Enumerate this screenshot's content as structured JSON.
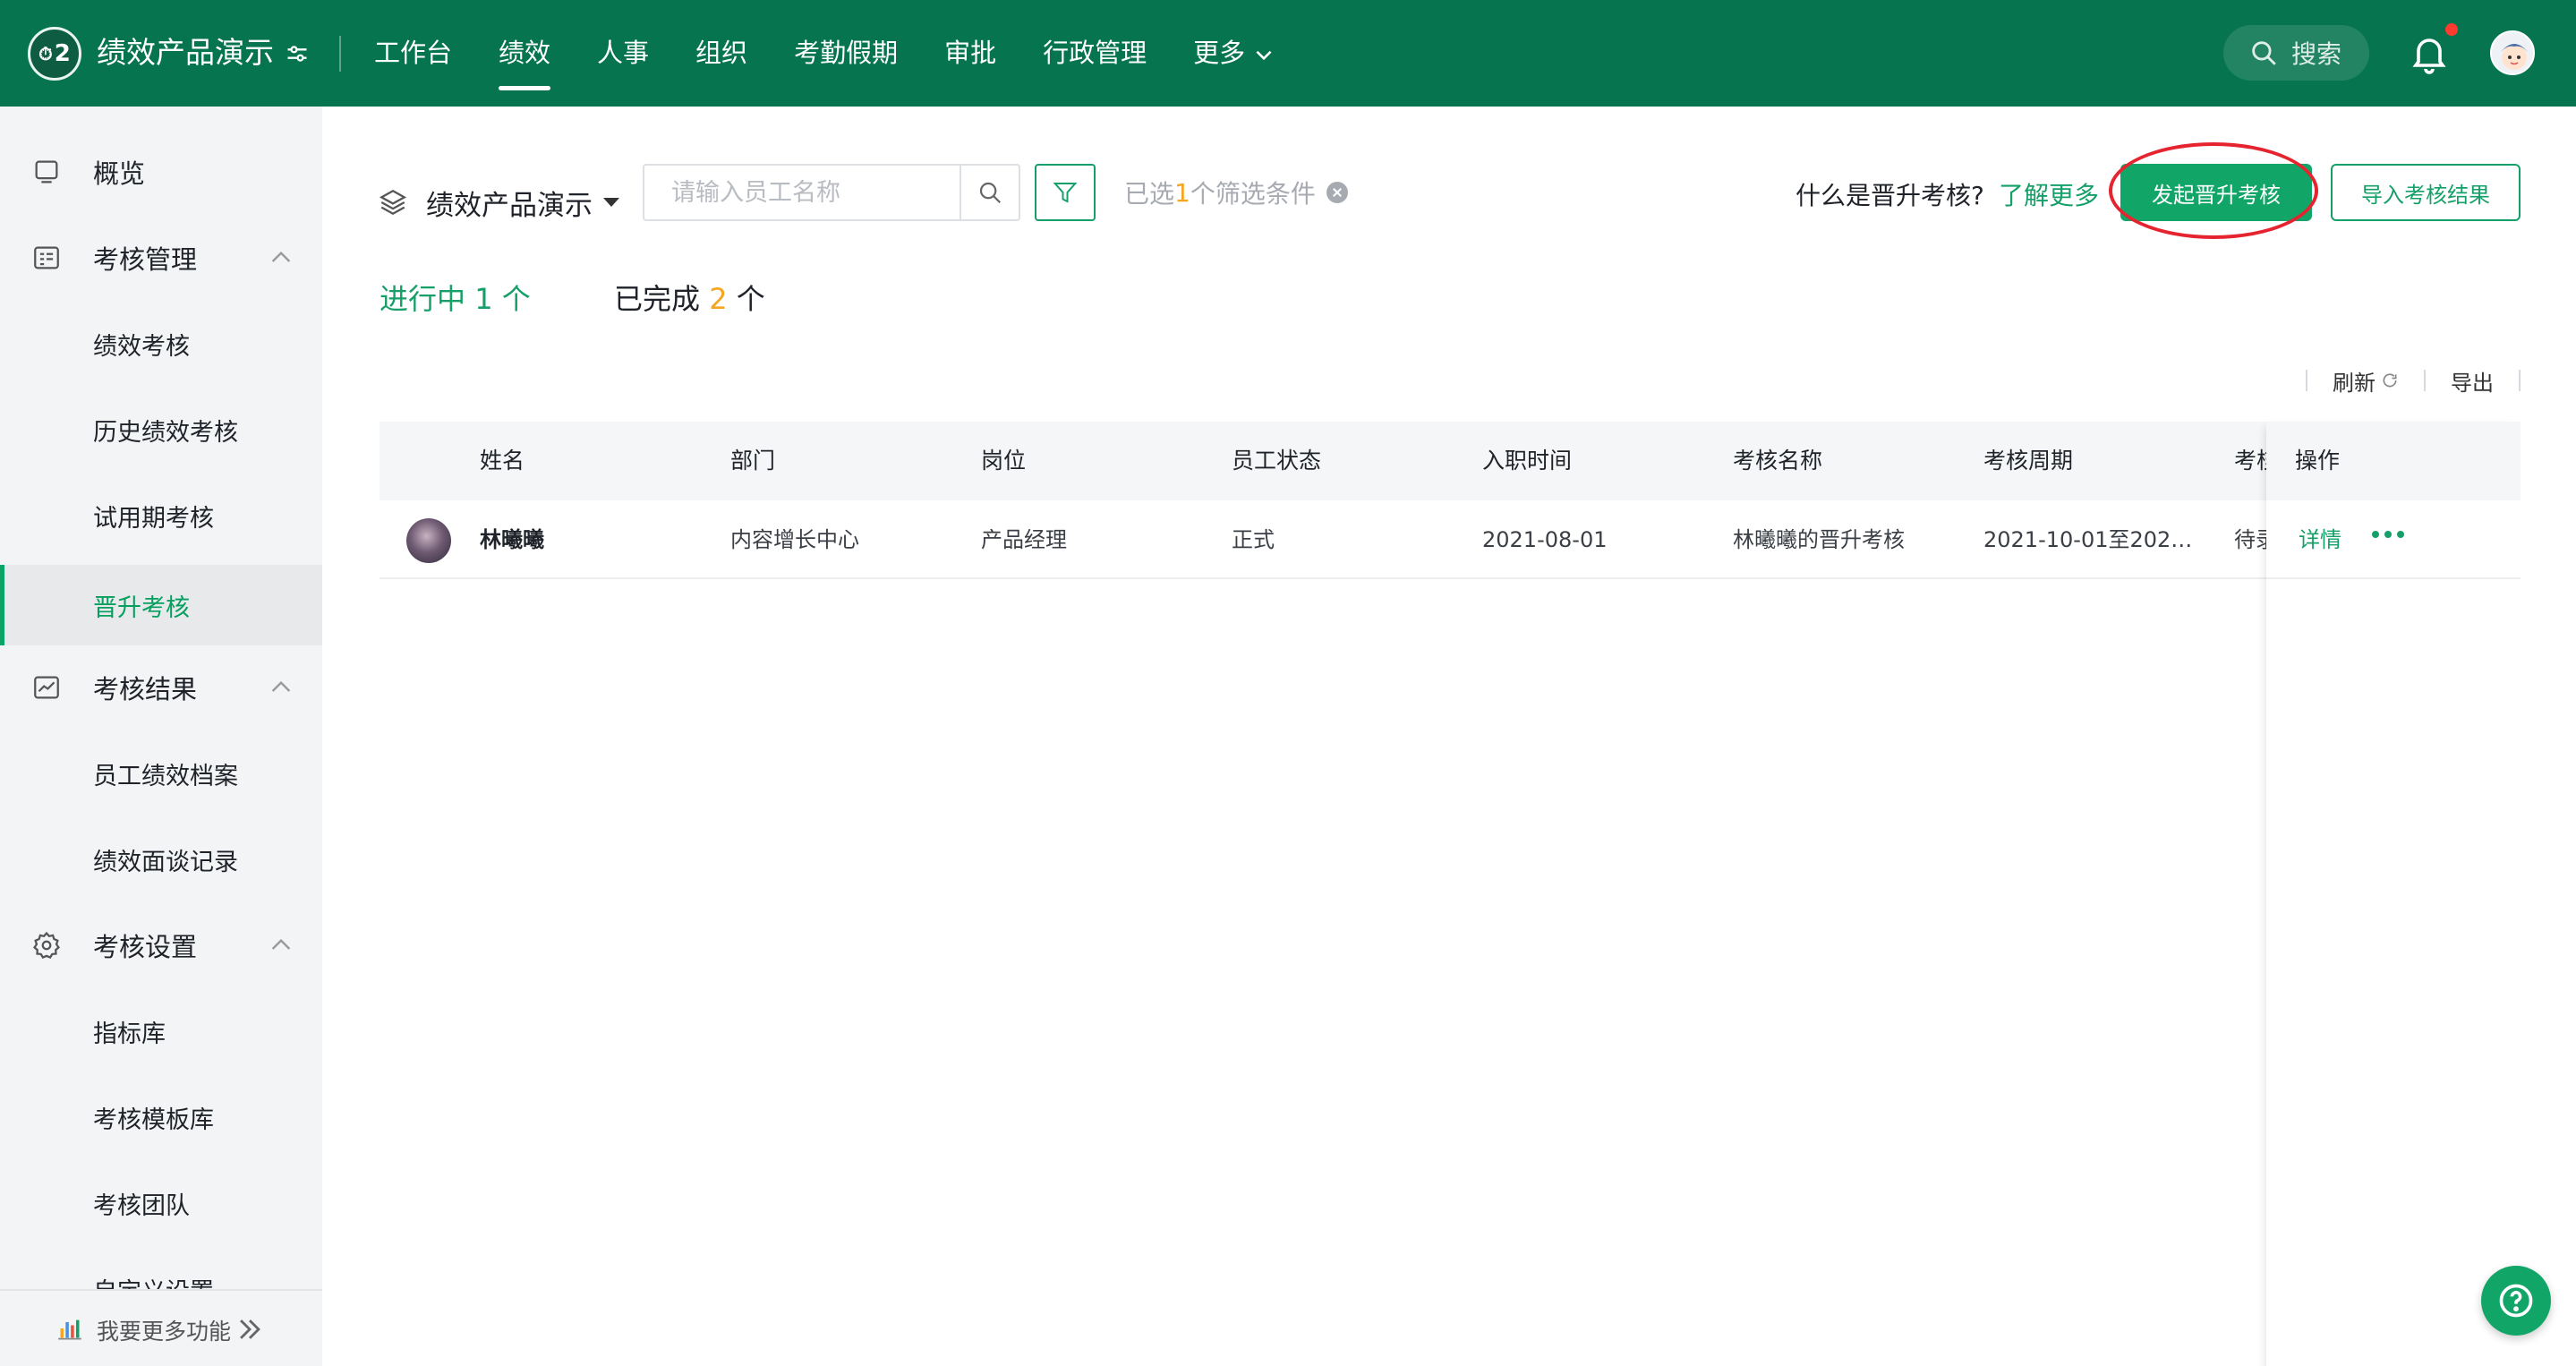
{
  "app": {
    "name": "绩效产品演示",
    "logo_text": "2"
  },
  "nav": {
    "items": [
      "工作台",
      "绩效",
      "人事",
      "组织",
      "考勤假期",
      "审批",
      "行政管理",
      "更多"
    ],
    "active": "绩效"
  },
  "top": {
    "search_label": "搜索",
    "notification_dot_color": "#ff3b30"
  },
  "sidebar": {
    "overview": "概览",
    "assess_mgmt": {
      "label": "考核管理",
      "items": [
        "绩效考核",
        "历史绩效考核",
        "试用期考核",
        "晋升考核"
      ]
    },
    "results": {
      "label": "考核结果",
      "items": [
        "员工绩效档案",
        "绩效面谈记录"
      ]
    },
    "settings": {
      "label": "考核设置",
      "items": [
        "指标库",
        "考核模板库",
        "考核团队",
        "自定义设置"
      ]
    },
    "active_item": "晋升考核",
    "bottom_label": "我要更多功能"
  },
  "toolbar": {
    "org_name": "绩效产品演示",
    "search_placeholder": "请输入员工名称",
    "filter_prefix": "已选",
    "filter_count": "1",
    "filter_suffix": "个筛选条件",
    "what_is": "什么是晋升考核?",
    "learn_more": "了解更多",
    "start_button": "发起晋升考核",
    "import_button": "导入考核结果"
  },
  "tabs": {
    "ongoing": {
      "label": "进行中",
      "count": "1",
      "unit": "个"
    },
    "done": {
      "label": "已完成",
      "count": "2",
      "unit": "个"
    }
  },
  "tools": {
    "refresh": "刷新",
    "export": "导出"
  },
  "table": {
    "columns": [
      "姓名",
      "部门",
      "岗位",
      "员工状态",
      "入职时间",
      "考核名称",
      "考核周期",
      "考核状态",
      "操作"
    ],
    "rows": [
      {
        "name": "林曦曦",
        "department": "内容增长中心",
        "position": "产品经理",
        "status": "正式",
        "join_date": "2021-08-01",
        "assess_name": "林曦曦的晋升考核",
        "period": "2021-10-01至202…",
        "assess_status": "待录",
        "detail": "详情"
      }
    ]
  },
  "colors": {
    "brand": "#05744f",
    "accent": "#16a069",
    "highlight_ring": "#e52430",
    "count_orange": "#f5a623"
  }
}
